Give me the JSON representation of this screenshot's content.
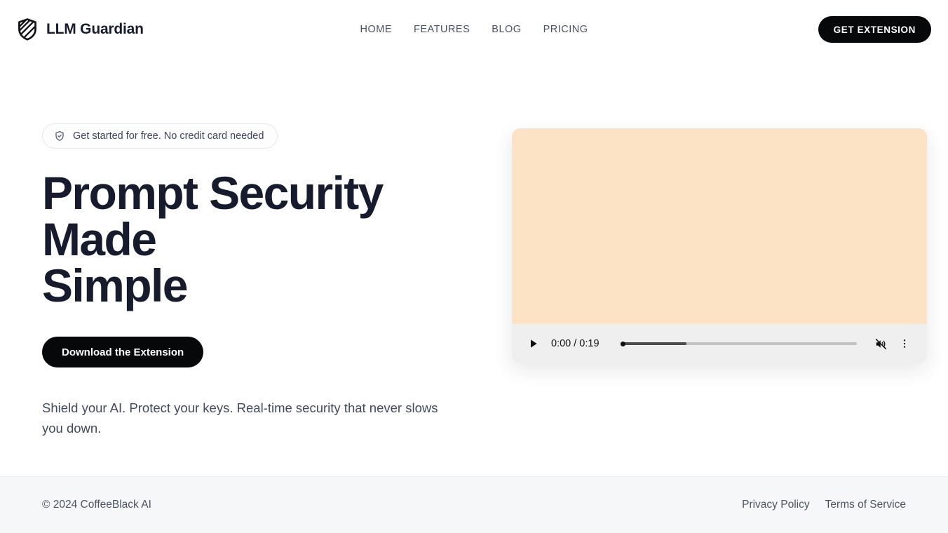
{
  "theme": {
    "page_bg": "#ffffff",
    "ink": "#161b2e",
    "muted_ink": "#4a5365",
    "accent_dark": "#07080a",
    "video_bg": "#fce3c6",
    "controls_bg": "#efefef",
    "footer_bg": "#f6f7f9"
  },
  "header": {
    "brand": {
      "name": "LLM Guardian",
      "icon": "shield-striped-icon"
    },
    "nav": [
      {
        "label": "HOME"
      },
      {
        "label": "FEATURES"
      },
      {
        "label": "BLOG"
      },
      {
        "label": "PRICING"
      }
    ],
    "cta_label": "GET EXTENSION"
  },
  "hero": {
    "badge": {
      "icon": "shield-check-icon",
      "text": "Get started for free. No credit card needed"
    },
    "title_lines": [
      "Prompt Security",
      "Made",
      "Simple"
    ],
    "cta_label": "Download the Extension",
    "subtitle": "Shield your AI. Protect your keys. Real-time security that never slows you down."
  },
  "video": {
    "play_icon": "play-icon",
    "current_time": "0:00",
    "duration": "0:19",
    "time_display": "0:00 / 0:19",
    "progress_percent": 0,
    "buffered_percent": 28,
    "muted": true,
    "mute_icon": "volume-muted-icon",
    "menu_icon": "kebab-menu-icon"
  },
  "footer": {
    "copyright": "© 2024 CoffeeBlack AI",
    "links": [
      {
        "label": "Privacy Policy"
      },
      {
        "label": "Terms of Service"
      }
    ]
  }
}
